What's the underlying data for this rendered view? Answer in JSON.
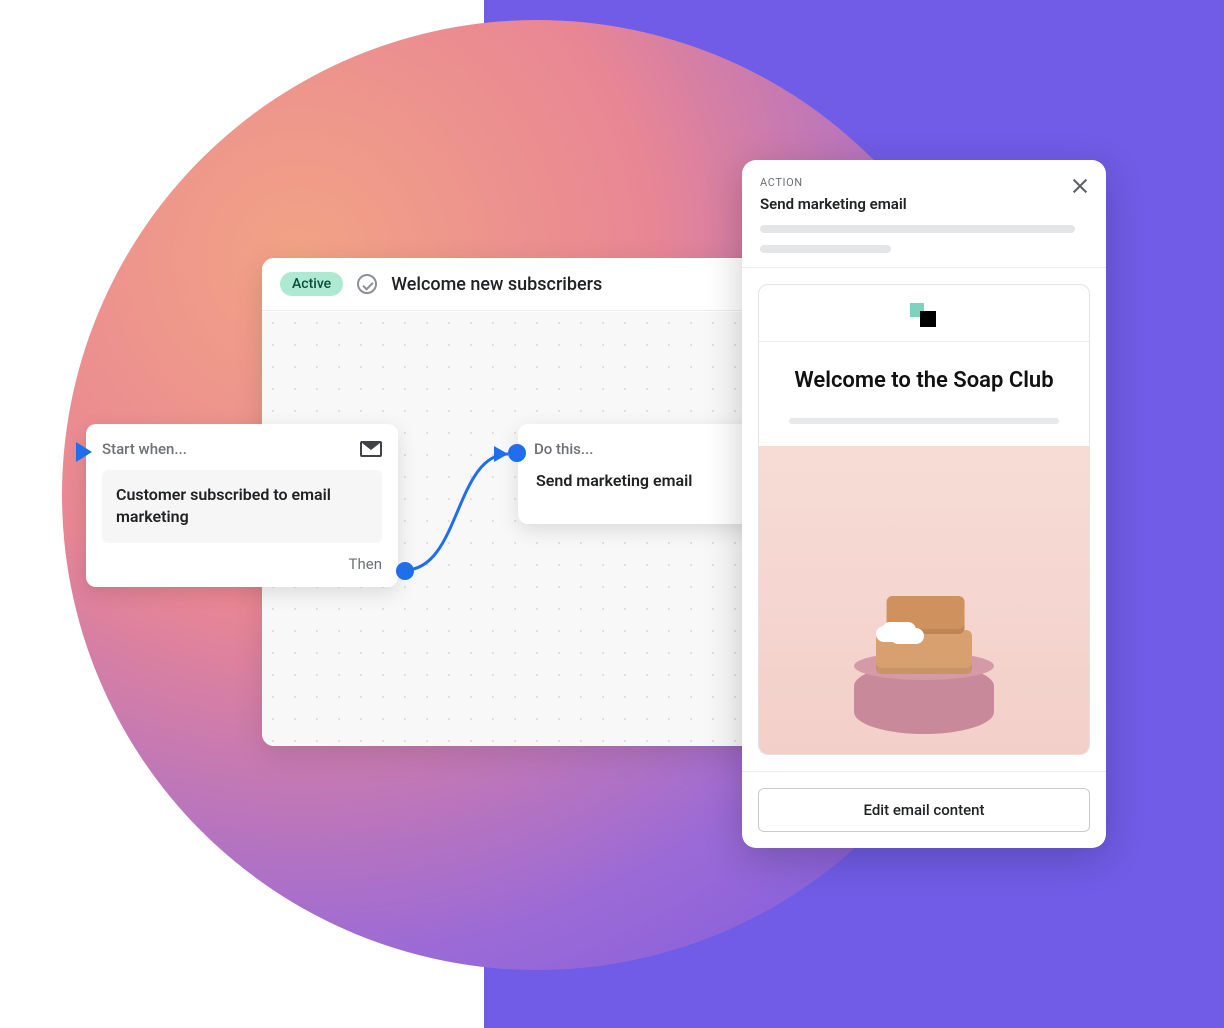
{
  "workflow": {
    "status_label": "Active",
    "title": "Welcome new subscribers"
  },
  "trigger_node": {
    "header_label": "Start when...",
    "body_text": "Customer subscribed to email marketing",
    "then_label": "Then"
  },
  "action_node": {
    "header_label": "Do this...",
    "body_text": "Send marketing email"
  },
  "panel": {
    "section_label": "ACTION",
    "title": "Send marketing email",
    "email_preview_title": "Welcome to the Soap Club",
    "edit_button_label": "Edit email content"
  }
}
